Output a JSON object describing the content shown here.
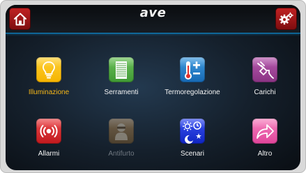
{
  "header": {
    "brand": "ave",
    "home_icon": "home-icon",
    "settings_icon": "settings-gears-icon"
  },
  "colors": {
    "accent_line": "#0e86c8",
    "corner_button": "#b01c1e",
    "active_label": "#f6b718"
  },
  "tiles": [
    {
      "label": "Illuminazione",
      "icon": "lightbulb-icon",
      "color": "#f5b400",
      "state": "selected"
    },
    {
      "label": "Serramenti",
      "icon": "shutter-icon",
      "color": "#4caa3f",
      "state": "normal"
    },
    {
      "label": "Termoregolazione",
      "icon": "thermometer-icon",
      "color": "#1b7cc9",
      "state": "normal"
    },
    {
      "label": "Carichi",
      "icon": "plug-icon",
      "color": "#9a3f93",
      "state": "normal"
    },
    {
      "label": "Allarmi",
      "icon": "alarm-icon",
      "color": "#d8262a",
      "state": "normal"
    },
    {
      "label": "Antifurto",
      "icon": "burglar-icon",
      "color": "#8a6a3a",
      "state": "disabled"
    },
    {
      "label": "Scenari",
      "icon": "scenes-icon",
      "color": "#1432d8",
      "state": "normal"
    },
    {
      "label": "Altro",
      "icon": "arrow-icon",
      "color": "#f25aa8",
      "state": "normal"
    }
  ]
}
